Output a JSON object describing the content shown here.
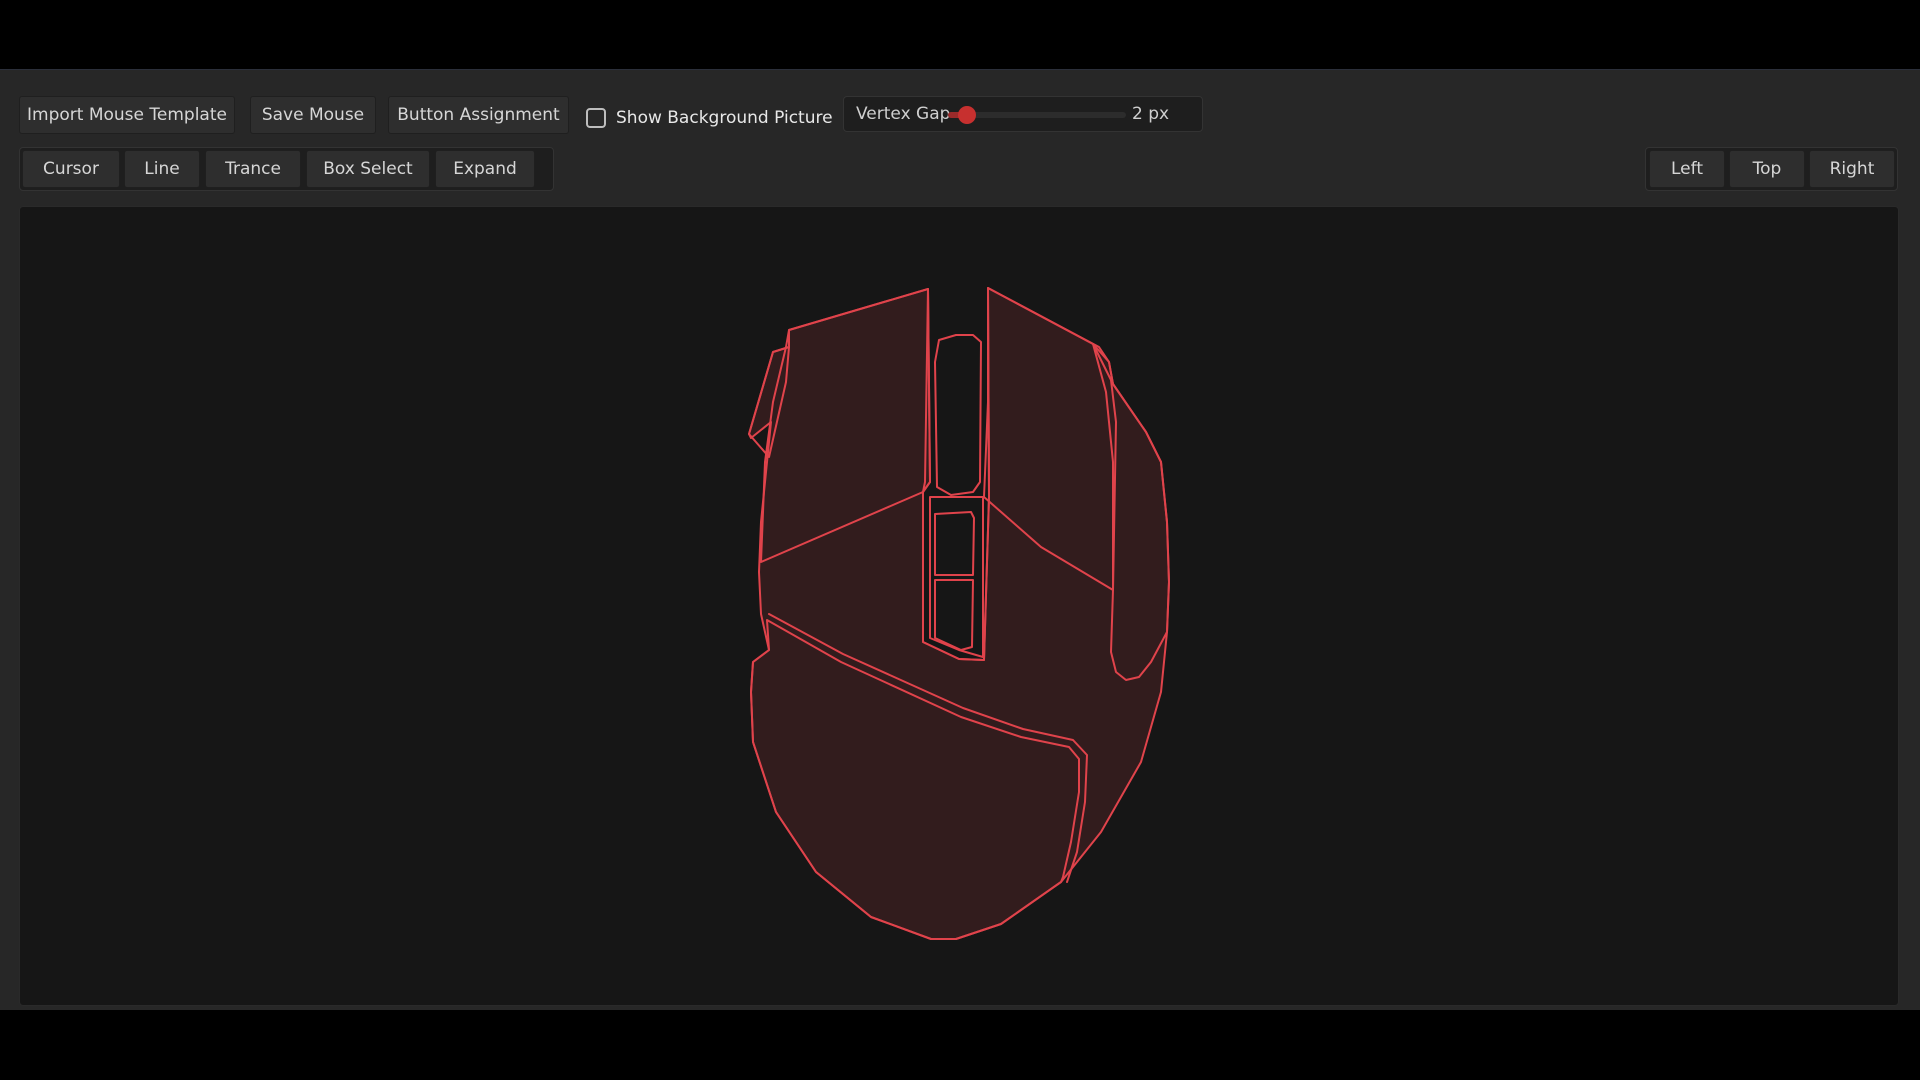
{
  "toolbar": {
    "import_label": "Import Mouse Template",
    "save_label": "Save Mouse",
    "assign_label": "Button Assignment",
    "show_bg_label": "Show Background Picture",
    "show_bg_checked": false,
    "vertex_gap": {
      "label": "Vertex Gap",
      "value_text": "2 px",
      "fraction": 0.07
    }
  },
  "tools": {
    "cursor": "Cursor",
    "line": "Line",
    "trance": "Trance",
    "box_select": "Box Select",
    "expand": "Expand"
  },
  "views": {
    "left": "Left",
    "top": "Top",
    "right": "Right"
  },
  "colors": {
    "outline": "#e0434b",
    "fill": "#321c1d",
    "slider": "#c7302f"
  }
}
